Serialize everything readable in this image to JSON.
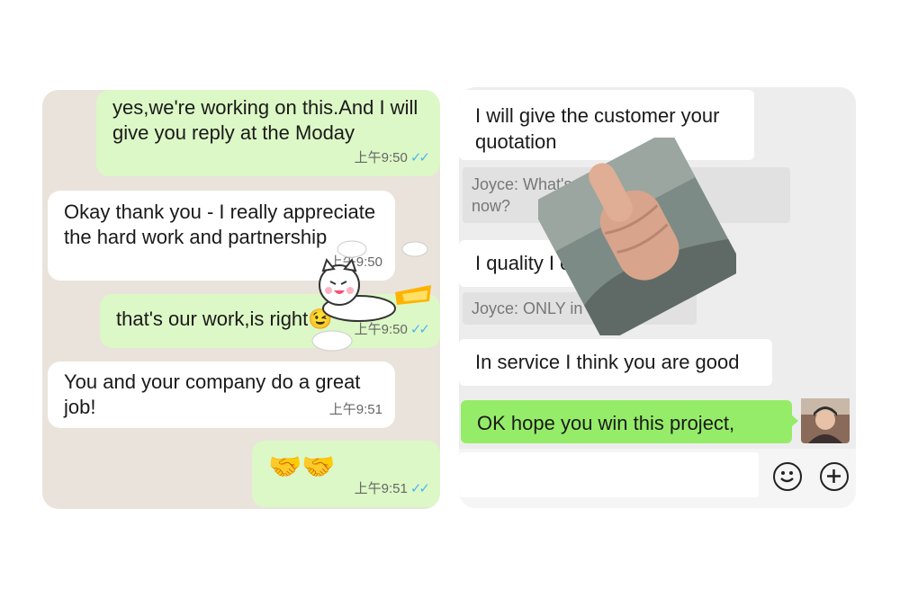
{
  "left_chat": {
    "messages": [
      {
        "dir": "out",
        "text": "yes,we're working on this.And I will\ngive you reply at the Moday",
        "time": "上午9:50",
        "ticks": "✓✓"
      },
      {
        "dir": "in",
        "text": "Okay thank you - I really appreciate\nthe hard work and partnership",
        "time": "上午9:50"
      },
      {
        "dir": "out",
        "text": "that's our work,is right😉",
        "time": "上午9:50",
        "ticks": "✓✓"
      },
      {
        "dir": "in",
        "text": "You and your company do a great\njob!",
        "time": "上午9:51"
      },
      {
        "dir": "out",
        "text": "🤝🤝",
        "time": "上午9:51",
        "ticks": "✓✓"
      }
    ],
    "sticker_icon": "cat-rocket-sticker-icon"
  },
  "right_chat": {
    "messages": [
      {
        "type": "in",
        "text": "I will give the customer your\nquotation"
      },
      {
        "type": "quote",
        "text": "Joyce:  What's            this project\nnow?"
      },
      {
        "type": "in",
        "text": "I quality I c"
      },
      {
        "type": "quote",
        "text": "Joyce:  ONLY in            on?"
      },
      {
        "type": "in",
        "text": "In service I think you are good"
      },
      {
        "type": "out",
        "text": "OK hope you win this project,"
      }
    ],
    "overlay_image": "thumbs-up-photo",
    "avatar": "user-avatar-photo",
    "composer": {
      "emoji_icon": "emoji-icon",
      "plus_icon": "plus-icon"
    }
  },
  "colors": {
    "whatsapp_out": "#dcf8c6",
    "whatsapp_bg": "#e9e3db",
    "wechat_out": "#95ec69",
    "wechat_bg": "#ededed",
    "tick_blue": "#4fb6ec"
  }
}
